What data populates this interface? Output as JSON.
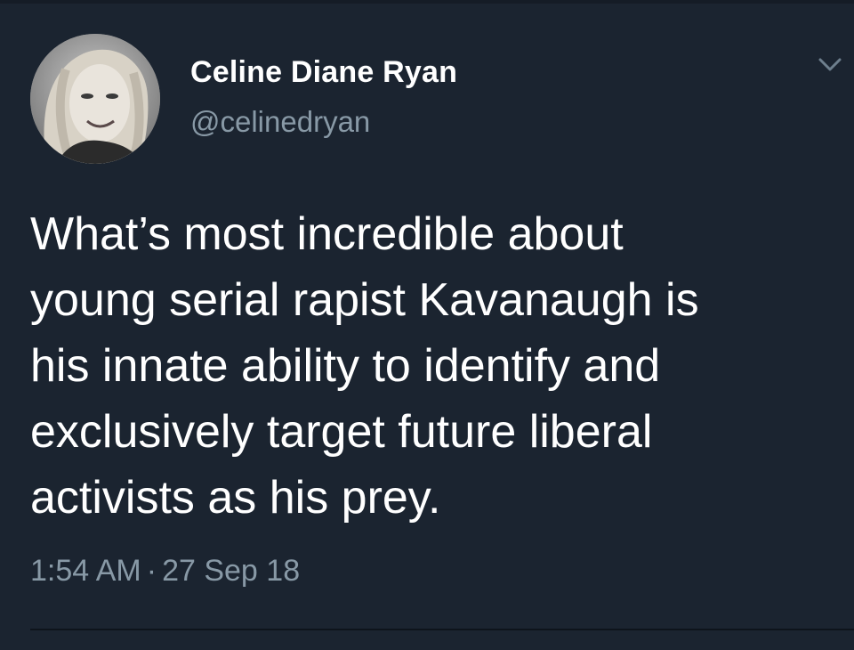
{
  "user": {
    "display_name": "Celine Diane Ryan",
    "handle": "@celinedryan"
  },
  "tweet": {
    "text": "What’s most incredible about\nyoung serial rapist Kavanaugh is\nhis innate ability to identify and\nexclusively target future liberal\nactivists as his prey.",
    "time": "1:54 AM",
    "separator": "·",
    "date": "27 Sep 18"
  },
  "icons": {
    "menu": "chevron-down-icon",
    "avatar": "profile-photo"
  },
  "colors": {
    "background": "#1b2430",
    "primary_text": "#ffffff",
    "secondary_text": "#8899a6"
  }
}
